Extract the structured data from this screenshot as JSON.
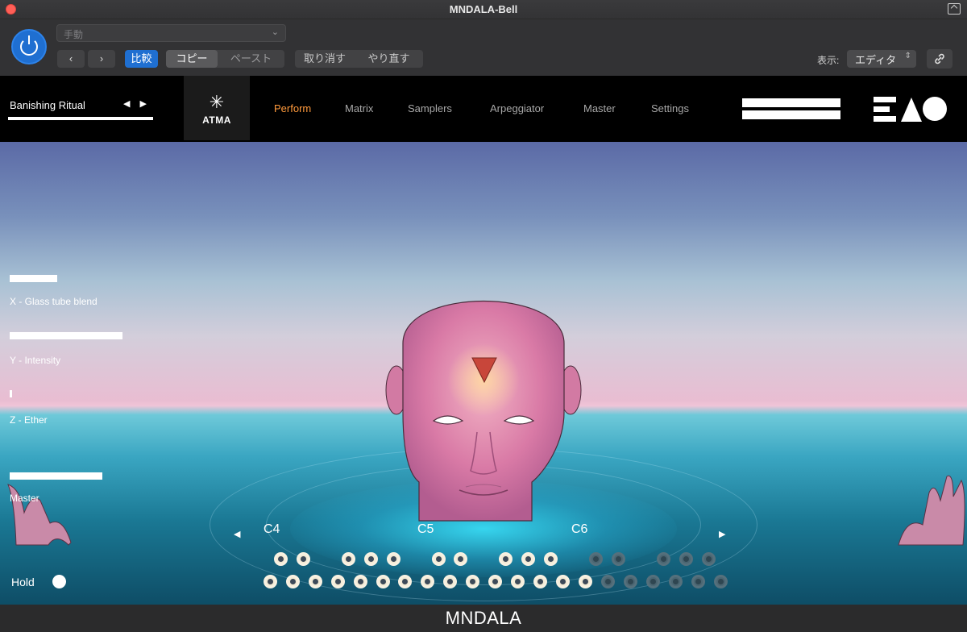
{
  "window": {
    "title": "MNDALA-Bell"
  },
  "host": {
    "preset_placeholder": "手動",
    "compare_label": "比較",
    "copy_label": "コピー",
    "paste_label": "ペースト",
    "undo_label": "取り消す",
    "redo_label": "やり直す",
    "view_label": "表示:",
    "view_value": "エディタ",
    "accent_color": "#1f6fd1"
  },
  "plugin": {
    "preset_name": "Banishing Ritual",
    "brand": "ATMA",
    "tabs": [
      {
        "label": "Perform",
        "active": true
      },
      {
        "label": "Matrix"
      },
      {
        "label": "Samplers"
      },
      {
        "label": "Arpeggiator"
      },
      {
        "label": "Master"
      },
      {
        "label": "Settings"
      }
    ],
    "active_tab_color": "#ff9a3c"
  },
  "parameters": [
    {
      "label": "X - Glass tube blend",
      "value": 0.42
    },
    {
      "label": "Y - Intensity",
      "value": 1.0
    },
    {
      "label": "Z - Ether",
      "value": 0.02
    },
    {
      "label": "Master",
      "value": 0.82
    }
  ],
  "keyboard": {
    "octaves": [
      "C4",
      "C5",
      "C6"
    ],
    "hold_label": "Hold",
    "hold_on": true
  },
  "footer": {
    "product": "MNDALA"
  }
}
